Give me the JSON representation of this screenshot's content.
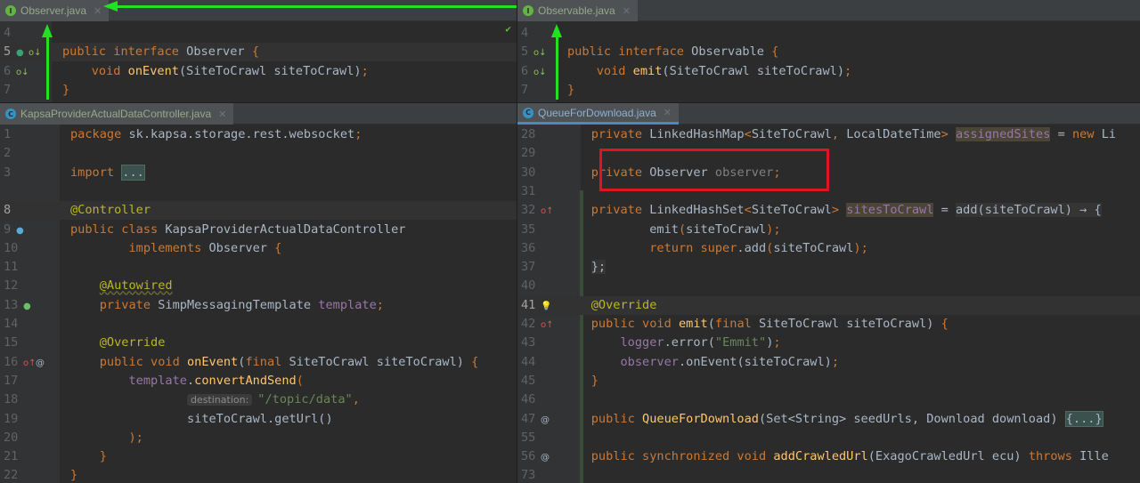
{
  "panes": {
    "top_left": {
      "tab": {
        "label": "Observer.java",
        "icon": "interface-icon",
        "icon_letter": "I"
      },
      "lines": [
        {
          "n": "4",
          "t": []
        },
        {
          "n": "5",
          "cur": true,
          "icons": [
            "implemented-icon",
            "override-down-icon"
          ],
          "t": [
            [
              "k",
              "public interface "
            ],
            [
              "t",
              "Observer "
            ],
            [
              "k",
              "{"
            ]
          ]
        },
        {
          "n": "6",
          "icons": [
            "override-down-icon"
          ],
          "t": [
            [
              "k",
              "    void "
            ],
            [
              "m",
              "onEvent"
            ],
            [
              "t",
              "(SiteToCrawl siteToCrawl)"
            ],
            [
              "k",
              ";"
            ]
          ]
        },
        {
          "n": "7",
          "t": [
            [
              "k",
              "}"
            ]
          ]
        }
      ]
    },
    "top_right": {
      "tab": {
        "label": "Observable.java",
        "icon": "interface-icon",
        "icon_letter": "I"
      },
      "lines": [
        {
          "n": "4",
          "t": []
        },
        {
          "n": "5",
          "icons": [
            "override-down-icon"
          ],
          "t": [
            [
              "k",
              "public interface "
            ],
            [
              "t",
              "Observable "
            ],
            [
              "k",
              "{"
            ]
          ]
        },
        {
          "n": "6",
          "icons": [
            "override-down-icon"
          ],
          "t": [
            [
              "k",
              "    void "
            ],
            [
              "m",
              "emit"
            ],
            [
              "t",
              "(SiteToCrawl siteToCrawl)"
            ],
            [
              "k",
              ";"
            ]
          ]
        },
        {
          "n": "7",
          "t": [
            [
              "k",
              "}"
            ]
          ]
        }
      ]
    },
    "bottom_left": {
      "tab": {
        "label": "KapsaProviderActualDataController.java",
        "icon": "class-icon",
        "icon_letter": "C"
      },
      "lines": [
        {
          "n": "1",
          "t": [
            [
              "k",
              "package "
            ],
            [
              "t",
              "sk.kapsa.storage.rest.websocket"
            ],
            [
              "k",
              ";"
            ]
          ]
        },
        {
          "n": "2",
          "t": []
        },
        {
          "n": "3",
          "t": [
            [
              "k",
              "import "
            ],
            [
              "fold",
              "..."
            ]
          ]
        },
        {
          "n": "",
          "t": []
        },
        {
          "n": "8",
          "cur": true,
          "t": [
            [
              "a",
              "@Controller"
            ]
          ]
        },
        {
          "n": "9",
          "icons": [
            "spring-bean-icon"
          ],
          "t": [
            [
              "k",
              "public class "
            ],
            [
              "t",
              "KapsaProviderActualDataController"
            ]
          ]
        },
        {
          "n": "10",
          "t": [
            [
              "k",
              "        implements "
            ],
            [
              "t",
              "Observer "
            ],
            [
              "k",
              "{"
            ]
          ]
        },
        {
          "n": "11",
          "t": []
        },
        {
          "n": "12",
          "t": [
            [
              "t",
              "    "
            ],
            [
              "a ul",
              "@Autowired"
            ]
          ]
        },
        {
          "n": "13",
          "icons": [
            "autowired-icon"
          ],
          "t": [
            [
              "k",
              "    private "
            ],
            [
              "t",
              "SimpMessagingTemplate "
            ],
            [
              "f",
              "template"
            ],
            [
              "k",
              ";"
            ]
          ]
        },
        {
          "n": "14",
          "t": []
        },
        {
          "n": "15",
          "t": [
            [
              "t",
              "    "
            ],
            [
              "a",
              "@Override"
            ]
          ]
        },
        {
          "n": "16",
          "icons": [
            "override-up-icon",
            "at-icon"
          ],
          "t": [
            [
              "k",
              "    public void "
            ],
            [
              "m",
              "onEvent"
            ],
            [
              "t",
              "("
            ],
            [
              "k",
              "final "
            ],
            [
              "t",
              "SiteToCrawl siteToCrawl) "
            ],
            [
              "k",
              "{"
            ]
          ]
        },
        {
          "n": "17",
          "t": [
            [
              "t",
              "        "
            ],
            [
              "f",
              "template"
            ],
            [
              "t",
              "."
            ],
            [
              "m",
              "convertAndSend"
            ],
            [
              "k",
              "("
            ]
          ]
        },
        {
          "n": "18",
          "t": [
            [
              "t",
              "                "
            ],
            [
              "hint",
              "destination:"
            ],
            [
              "s",
              "\"/topic/data\""
            ],
            [
              "k",
              ","
            ]
          ]
        },
        {
          "n": "19",
          "t": [
            [
              "t",
              "                siteToCrawl.getUrl()"
            ]
          ]
        },
        {
          "n": "20",
          "t": [
            [
              "k",
              "        );"
            ]
          ]
        },
        {
          "n": "21",
          "t": [
            [
              "k",
              "    }"
            ]
          ]
        },
        {
          "n": "22",
          "t": [
            [
              "k",
              "}"
            ]
          ]
        }
      ]
    },
    "bottom_right": {
      "tab": {
        "label": "QueueForDownload.java",
        "icon": "class-icon",
        "icon_letter": "C"
      },
      "lines": [
        {
          "n": "28",
          "t": [
            [
              "k",
              "    private "
            ],
            [
              "t",
              "LinkedHashMap"
            ],
            [
              "k",
              "<"
            ],
            [
              "t",
              "SiteToCrawl"
            ],
            [
              "k",
              ", "
            ],
            [
              "t",
              "LocalDateTime"
            ],
            [
              "k",
              "> "
            ],
            [
              "f fh",
              "assignedSites"
            ],
            [
              "t",
              " = "
            ],
            [
              "k",
              "new "
            ],
            [
              "t",
              "Li"
            ]
          ]
        },
        {
          "n": "29",
          "t": []
        },
        {
          "n": "30",
          "t": [
            [
              "k",
              "    private "
            ],
            [
              "t",
              "Observer "
            ],
            [
              "g",
              "observer"
            ],
            [
              "k",
              ";"
            ]
          ]
        },
        {
          "n": "31",
          "t": []
        },
        {
          "n": "32",
          "icons": [
            "override-up-icon"
          ],
          "t": [
            [
              "k",
              "    private "
            ],
            [
              "t",
              "LinkedHashSet"
            ],
            [
              "k",
              "<"
            ],
            [
              "t",
              "SiteToCrawl"
            ],
            [
              "k",
              "> "
            ],
            [
              "f fh",
              "sitesToCrawl"
            ],
            [
              "t",
              " = "
            ],
            [
              "lam",
              "add(siteToCrawl) → {"
            ]
          ]
        },
        {
          "n": "35",
          "t": [
            [
              "t",
              "            emit"
            ],
            [
              "k",
              "("
            ],
            [
              "t",
              "siteToCrawl"
            ],
            [
              "k",
              ");"
            ]
          ]
        },
        {
          "n": "36",
          "t": [
            [
              "k",
              "            return super"
            ],
            [
              "t",
              ".add"
            ],
            [
              "k",
              "("
            ],
            [
              "t",
              "siteToCrawl"
            ],
            [
              "k",
              ");"
            ]
          ]
        },
        {
          "n": "37",
          "t": [
            [
              "t",
              "    "
            ],
            [
              "lam",
              "};"
            ]
          ]
        },
        {
          "n": "40",
          "t": []
        },
        {
          "n": "41",
          "cur": true,
          "icons": [
            "bulb-icon"
          ],
          "t": [
            [
              "t",
              "    "
            ],
            [
              "a",
              "@Override"
            ]
          ]
        },
        {
          "n": "42",
          "icons": [
            "override-up-icon"
          ],
          "t": [
            [
              "k",
              "    public void "
            ],
            [
              "m",
              "emit"
            ],
            [
              "t",
              "("
            ],
            [
              "k",
              "final "
            ],
            [
              "t",
              "SiteToCrawl siteToCrawl) "
            ],
            [
              "k",
              "{"
            ]
          ]
        },
        {
          "n": "43",
          "t": [
            [
              "t",
              "        "
            ],
            [
              "f",
              "logger"
            ],
            [
              "t",
              ".error("
            ],
            [
              "s",
              "\"Emmit\""
            ],
            [
              "t",
              ")"
            ],
            [
              "k",
              ";"
            ]
          ]
        },
        {
          "n": "44",
          "t": [
            [
              "t",
              "        "
            ],
            [
              "f",
              "observer"
            ],
            [
              "t",
              ".onEvent(siteToCrawl)"
            ],
            [
              "k",
              ";"
            ]
          ]
        },
        {
          "n": "45",
          "t": [
            [
              "k",
              "    }"
            ]
          ]
        },
        {
          "n": "46",
          "t": []
        },
        {
          "n": "47",
          "icons": [
            "at-icon"
          ],
          "t": [
            [
              "k",
              "    public "
            ],
            [
              "m",
              "QueueForDownload"
            ],
            [
              "t",
              "(Set<String> seedUrls, Download download) "
            ],
            [
              "fold",
              "{...}"
            ]
          ]
        },
        {
          "n": "55",
          "t": []
        },
        {
          "n": "56",
          "icons": [
            "at-icon"
          ],
          "t": [
            [
              "k",
              "    public synchronized void "
            ],
            [
              "m",
              "addCrawledUrl"
            ],
            [
              "t",
              "(ExagoCrawledUrl ecu) "
            ],
            [
              "k",
              "throws "
            ],
            [
              "t",
              "Ille"
            ]
          ]
        },
        {
          "n": "73",
          "t": []
        }
      ]
    }
  },
  "colors": {
    "arrow": "#22e022",
    "highlight_box": "#e0141e",
    "background": "#2b2b2b"
  }
}
